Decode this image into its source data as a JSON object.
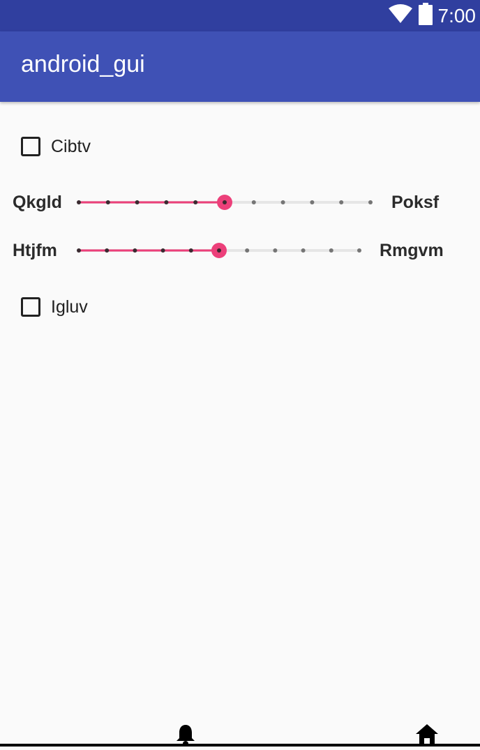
{
  "status_bar": {
    "time": "7:00",
    "icons": [
      "wifi-icon",
      "battery-icon"
    ]
  },
  "app_bar": {
    "title": "android_gui"
  },
  "checkbox_1": {
    "label": "Cibtv",
    "checked": false
  },
  "slider_1": {
    "left_label": "Qkgld",
    "right_label": "Poksf",
    "steps": 10,
    "value": 5
  },
  "slider_2": {
    "left_label": "Htjfm",
    "right_label": "Rmgvm",
    "steps": 10,
    "value": 5
  },
  "checkbox_2": {
    "label": "Igluv",
    "checked": false
  },
  "nav_bar": {
    "icons": [
      "bell-icon",
      "home-icon"
    ]
  },
  "colors": {
    "status_bar": "#303f9f",
    "app_bar": "#3f51b5",
    "accent": "#ec407a",
    "background": "#fafafa"
  }
}
